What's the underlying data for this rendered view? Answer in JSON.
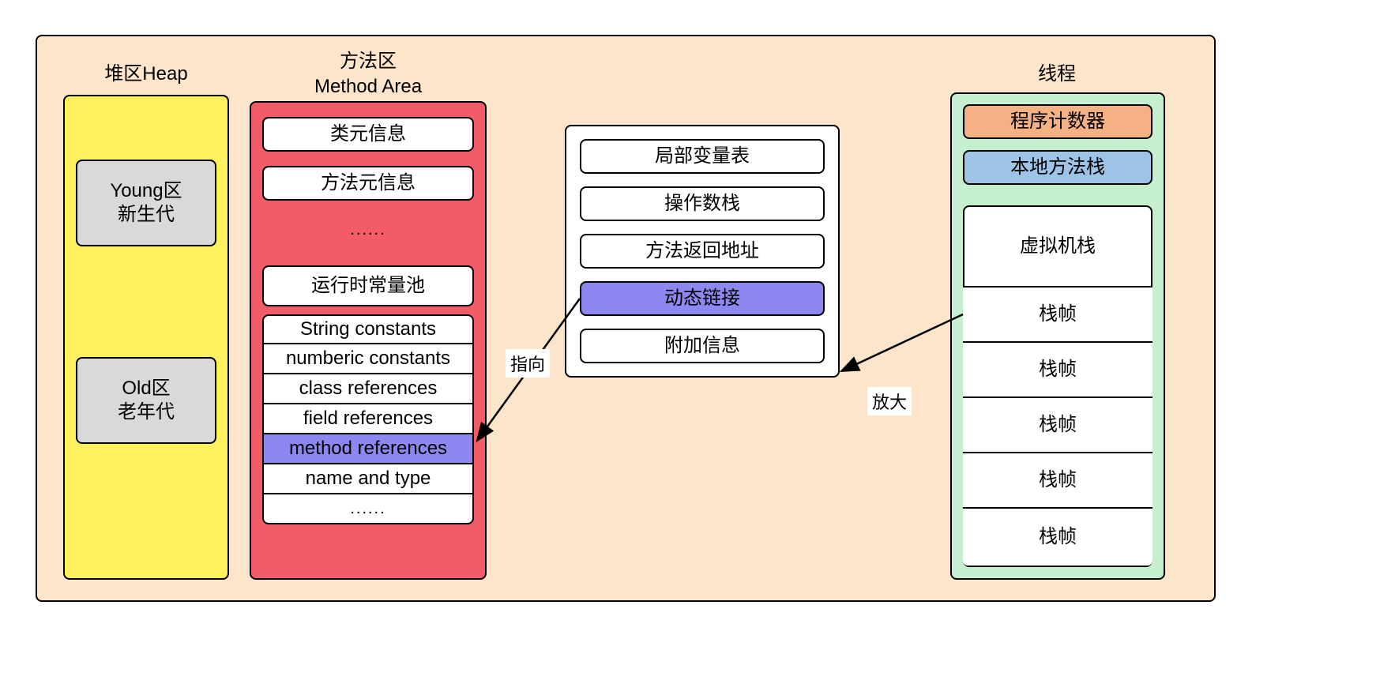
{
  "outer": {
    "bg": "#fce5cb"
  },
  "heap": {
    "title": "堆区Heap",
    "bg": "#fdf160",
    "young": "Young区\n新生代",
    "old": "Old区\n老年代"
  },
  "method_area": {
    "title1": "方法区",
    "title2": "Method Area",
    "bg": "#f25c66",
    "items_top": [
      "类元信息",
      "方法元信息"
    ],
    "ellipsis1": "......",
    "constant_pool_header": "运行时常量池",
    "constant_pool_items": [
      "String constants",
      "numberic constants",
      "class references",
      "field references",
      "method references",
      "name and type"
    ],
    "ellipsis2": "......",
    "highlight_index": 4
  },
  "stack_frame": {
    "items": [
      "局部变量表",
      "操作数栈",
      "方法返回地址",
      "动态链接",
      "附加信息"
    ],
    "highlight_index": 3
  },
  "thread": {
    "title": "线程",
    "bg": "#c5efce",
    "pc": "程序计数器",
    "native_stack": "本地方法栈",
    "vm_stack_title": "虚拟机栈",
    "frames": [
      "栈帧",
      "栈帧",
      "栈帧",
      "栈帧",
      "栈帧"
    ]
  },
  "arrows": {
    "points_to": "指向",
    "zoom": "放大"
  }
}
